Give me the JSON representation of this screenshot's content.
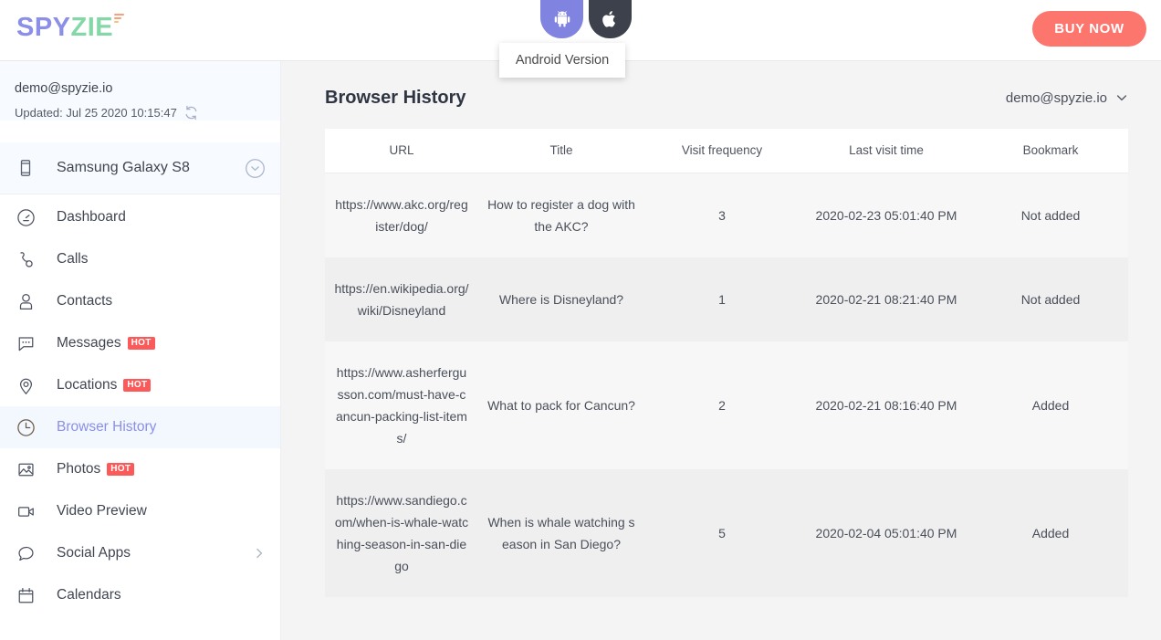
{
  "brand": {
    "logo_spy": "SPY",
    "logo_zie": "ZIE"
  },
  "topbar": {
    "buy_now_label": "BUY NOW",
    "os_tabs": [
      {
        "id": "android",
        "icon": "android-icon",
        "active": true
      },
      {
        "id": "ios",
        "icon": "apple-icon",
        "active": false
      }
    ],
    "tooltip_label": "Android Version"
  },
  "sidebar": {
    "account_email": "demo@spyzie.io",
    "updated_label": "Updated: Jul 25 2020 10:15:47",
    "refresh_icon": "refresh-icon",
    "device": {
      "icon": "phone-icon",
      "name": "Samsung Galaxy S8",
      "chevron": "chevron-down-circle-icon"
    },
    "items": [
      {
        "label": "Dashboard",
        "icon": "gauge-icon",
        "badge": "",
        "active": false,
        "expandable": false
      },
      {
        "label": "Calls",
        "icon": "phone-call-icon",
        "badge": "",
        "active": false,
        "expandable": false
      },
      {
        "label": "Contacts",
        "icon": "person-icon",
        "badge": "",
        "active": false,
        "expandable": false
      },
      {
        "label": "Messages",
        "icon": "chat-bubble-icon",
        "badge": "HOT",
        "active": false,
        "expandable": false
      },
      {
        "label": "Locations",
        "icon": "map-pin-icon",
        "badge": "HOT",
        "active": false,
        "expandable": false
      },
      {
        "label": "Browser History",
        "icon": "clock-icon",
        "badge": "",
        "active": true,
        "expandable": false
      },
      {
        "label": "Photos",
        "icon": "image-icon",
        "badge": "HOT",
        "active": false,
        "expandable": false
      },
      {
        "label": "Video Preview",
        "icon": "video-camera-icon",
        "badge": "",
        "active": false,
        "expandable": false
      },
      {
        "label": "Social Apps",
        "icon": "speech-bubble-icon",
        "badge": "",
        "active": false,
        "expandable": true
      },
      {
        "label": "Calendars",
        "icon": "calendar-icon",
        "badge": "",
        "active": false,
        "expandable": false
      }
    ]
  },
  "main": {
    "page_title": "Browser History",
    "user_menu_label": "demo@spyzie.io",
    "table": {
      "columns": [
        "URL",
        "Title",
        "Visit frequency",
        "Last visit time",
        "Bookmark"
      ],
      "rows": [
        {
          "url": "https://www.akc.org/register/dog/",
          "title": "How to register a dog with the AKC?",
          "frequency": "3",
          "last_visit": "2020-02-23 05:01:40 PM",
          "bookmark": "Not added"
        },
        {
          "url": "https://en.wikipedia.org/wiki/Disneyland",
          "title": "Where is Disneyland?",
          "frequency": "1",
          "last_visit": "2020-02-21 08:21:40 PM",
          "bookmark": "Not added"
        },
        {
          "url": "https://www.asherfergusson.com/must-have-cancun-packing-list-items/",
          "title": "What to pack for Cancun?",
          "frequency": "2",
          "last_visit": "2020-02-21 08:16:40 PM",
          "bookmark": "Added"
        },
        {
          "url": "https://www.sandiego.com/when-is-whale-watching-season-in-san-diego",
          "title": "When is whale watching season in San Diego?",
          "frequency": "5",
          "last_visit": "2020-02-04 05:01:40 PM",
          "bookmark": "Added"
        }
      ]
    }
  },
  "colors": {
    "brand_purple": "#8b8fe8",
    "brand_green": "#84d8a8",
    "buy_now": "#fc766e",
    "hot_badge": "#fb5a5a",
    "android_tab": "#8084e0",
    "ios_tab": "#3c414c",
    "active_nav_bg": "#f2f8fe"
  }
}
